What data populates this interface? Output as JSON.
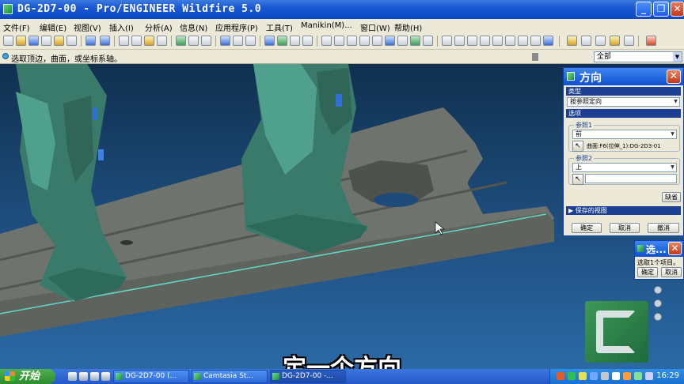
{
  "window": {
    "title": "DG-2D7-00 - Pro/ENGINEER Wildfire 5.0",
    "buttons": {
      "minimize": "_",
      "maximize": "❐",
      "close": "✕"
    }
  },
  "menu": [
    "文件(F)",
    "编辑(E)",
    "视图(V)",
    "插入(I)",
    "分析(A)",
    "信息(N)",
    "应用程序(P)",
    "工具(T)",
    "Manikin(M)...",
    "窗口(W)",
    "帮助(H)"
  ],
  "statusbar": {
    "message": "选取顶边，曲面，或坐标系轴。",
    "filter": "全部"
  },
  "direction_dialog": {
    "title": "方向",
    "type_section": "类型",
    "type_value": "按参照定向",
    "options_section": "选项",
    "ref1_label": "参照1",
    "ref1_value": "前",
    "ref1_selection": "曲面:F6(拉伸_1):DG-2D3-01",
    "ref2_label": "参照2",
    "ref2_value": "上",
    "ref2_selection": "",
    "default_button": "缺省",
    "saved_views": "保存的视图",
    "ok": "确定",
    "cancel": "取消",
    "undo": "撤消"
  },
  "select_dialog": {
    "title": "选...",
    "message": "选取1个项目。",
    "ok": "确定",
    "cancel": "取消"
  },
  "subtitle": "定一个方向",
  "taskbar": {
    "start": "开始",
    "tasks": [
      "DG-2D7-00 (...",
      "Camtasia St...",
      "DG-2D7-00 -..."
    ],
    "clock": "16:29"
  },
  "colors": {
    "viewport_top": "#10304f",
    "viewport_bottom": "#2b69a6",
    "plate": "#6e726c",
    "fixture": "#3a7a6a",
    "edge_highlight": "#5fd8c8"
  },
  "icons": {
    "toolbar": [
      "new-icon",
      "open-icon",
      "save-icon",
      "print-icon",
      "mail-icon",
      "undo-icon",
      "redo-icon",
      "cut-icon",
      "copy-icon",
      "paste-icon",
      "regenerate-icon",
      "search-icon",
      "select-icon",
      "repaint-icon",
      "spin-icon",
      "zoom-in-icon",
      "zoom-out-icon",
      "refit-icon",
      "orient-icon",
      "saved-views-icon",
      "layers-icon",
      "appearance-icon",
      "wireframe-icon",
      "hidden-line-icon",
      "no-hidden-icon",
      "shading-icon",
      "datum-plane-icon",
      "datum-axis-icon",
      "datum-point-icon",
      "csys-icon",
      "help-icon"
    ]
  }
}
